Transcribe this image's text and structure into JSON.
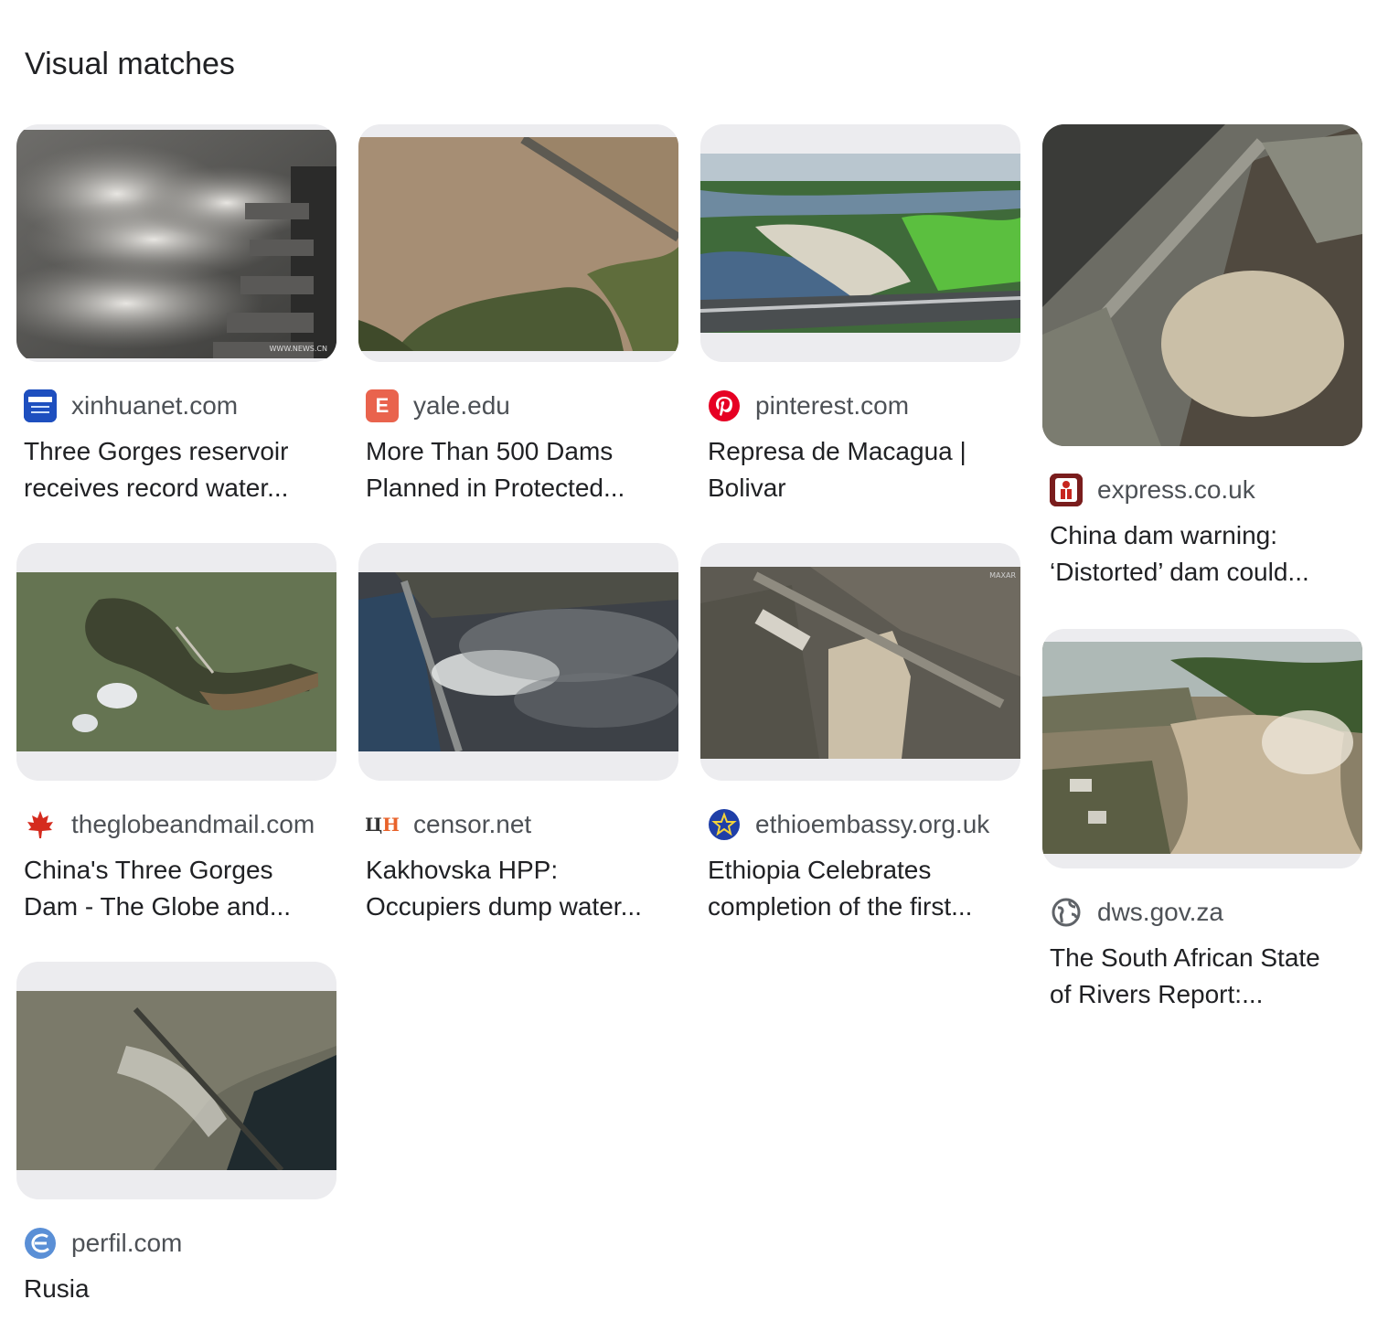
{
  "section": {
    "heading": "Visual matches"
  },
  "results": [
    {
      "site": "xinhuanet.com",
      "title_line1": "Three Gorges reservoir",
      "title_line2": "receives record water...",
      "favicon": "xinhua-logo-icon",
      "image_watermark": "WWW.NEWS.CN"
    },
    {
      "site": "yale.edu",
      "title_line1": "More Than 500 Dams",
      "title_line2": "Planned in Protected...",
      "favicon": "letter-e-icon",
      "favicon_letter": "E"
    },
    {
      "site": "pinterest.com",
      "title_line1": "Represa de Macagua |",
      "title_line2": "Bolivar",
      "favicon": "pinterest-icon"
    },
    {
      "site": "express.co.uk",
      "title_line1": "China dam warning:",
      "title_line2": "‘Distorted’ dam could...",
      "favicon": "express-crusader-icon"
    },
    {
      "site": "theglobeandmail.com",
      "title_line1": "China's Three Gorges",
      "title_line2": "Dam - The Globe and...",
      "favicon": "maple-leaf-icon"
    },
    {
      "site": "censor.net",
      "title_line1": "Kakhovska HPP:",
      "title_line2": "Occupiers dump water...",
      "favicon": "censor-logo-icon",
      "favicon_text": "ЦН"
    },
    {
      "site": "ethioembassy.org.uk",
      "title_line1": "Ethiopia Celebrates",
      "title_line2": "completion of the first...",
      "favicon": "ethiopian-emblem-icon",
      "image_watermark": "MAXAR"
    },
    {
      "site": "dws.gov.za",
      "title_line1": "The South African State",
      "title_line2": "of Rivers Report:...",
      "favicon": "globe-icon"
    },
    {
      "site": "perfil.com",
      "title_line1": "Rusia",
      "title_line2": "",
      "favicon": "perfil-logo-icon"
    }
  ]
}
